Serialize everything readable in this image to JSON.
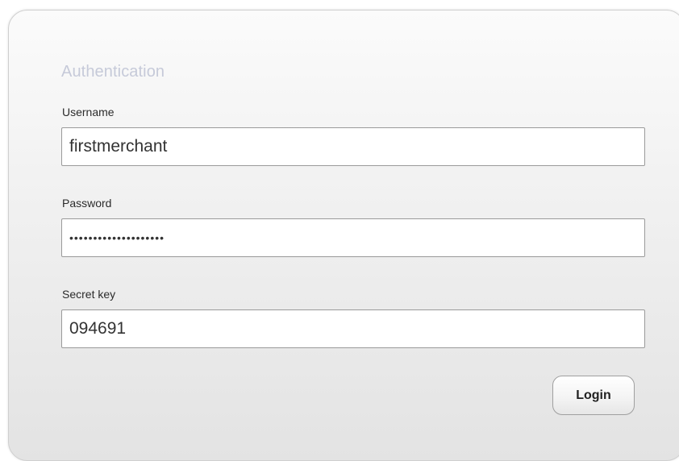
{
  "form": {
    "title": "Authentication",
    "username": {
      "label": "Username",
      "value": "firstmerchant"
    },
    "password": {
      "label": "Password",
      "value": "••••••••••••••••••••"
    },
    "secret_key": {
      "label": "Secret key",
      "value": "094691"
    },
    "login_label": "Login"
  }
}
